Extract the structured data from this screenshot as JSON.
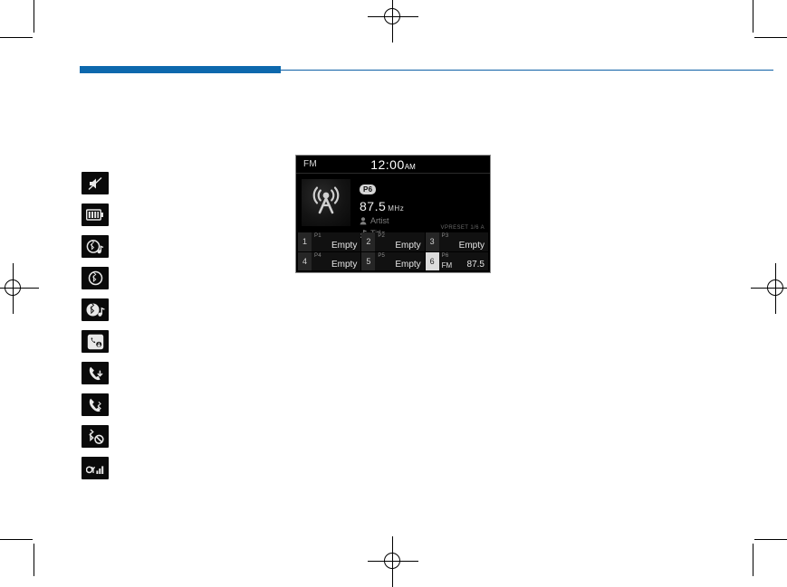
{
  "page": {
    "accent_color": "#0d68ad",
    "rule_color": "#0c5fa5"
  },
  "icon_column": {
    "items": [
      {
        "name": "mute-icon",
        "label": "Mute"
      },
      {
        "name": "battery-icon",
        "label": "Battery"
      },
      {
        "name": "bluetooth-audio-streaming-icon",
        "label": "Bluetooth Audio Streaming"
      },
      {
        "name": "bluetooth-icon",
        "label": "Bluetooth"
      },
      {
        "name": "bluetooth-music-icon",
        "label": "Bluetooth Music"
      },
      {
        "name": "phone-message-icon",
        "label": "Phone Message"
      },
      {
        "name": "call-download-icon",
        "label": "Call Download"
      },
      {
        "name": "call-bluetooth-icon",
        "label": "Call Bluetooth"
      },
      {
        "name": "bluetooth-disconnected-icon",
        "label": "Bluetooth Disconnected"
      },
      {
        "name": "signal-strength-icon",
        "label": "Signal Strength"
      }
    ]
  },
  "headunit": {
    "status": {
      "band": "FM",
      "clock_time": "12:00",
      "clock_ampm": "AM"
    },
    "now_playing": {
      "preset_badge": "P6",
      "frequency": "87.5",
      "frequency_unit": "MHz",
      "artist": "Artist",
      "title": "Title",
      "station_logo_icon": "radio-broadcast-tower-icon"
    },
    "preset_page_label": "VPRESET 1/6 A",
    "presets": [
      {
        "num": "1",
        "tag": "P1",
        "text": "Empty",
        "sub": "",
        "active": false
      },
      {
        "num": "2",
        "tag": "P2",
        "text": "Empty",
        "sub": "",
        "active": false
      },
      {
        "num": "3",
        "tag": "P3",
        "text": "Empty",
        "sub": "",
        "active": false
      },
      {
        "num": "4",
        "tag": "P4",
        "text": "Empty",
        "sub": "",
        "active": false
      },
      {
        "num": "5",
        "tag": "P5",
        "text": "Empty",
        "sub": "",
        "active": false
      },
      {
        "num": "6",
        "tag": "P6",
        "text": "87.5",
        "sub": "FM",
        "active": true
      }
    ]
  }
}
